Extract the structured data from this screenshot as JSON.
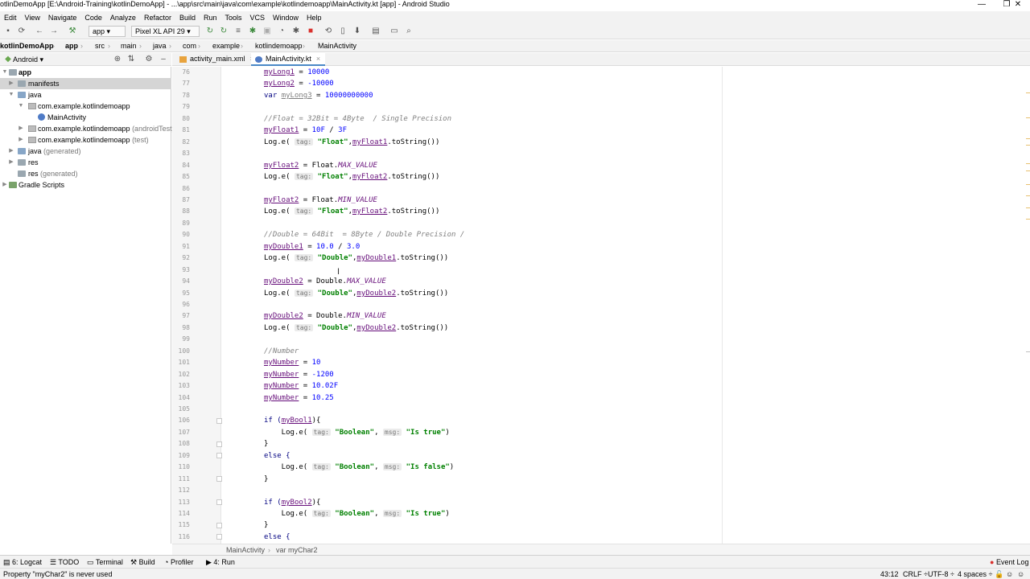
{
  "window": {
    "title": "otlinDemoApp [E:\\Android-Training\\kotlinDemoApp] - ...\\app\\src\\main\\java\\com\\example\\kotlindemoapp\\MainActivity.kt [app] - Android Studio",
    "minimize": "—",
    "restore": "❐",
    "close": "✕"
  },
  "menu": [
    "Edit",
    "View",
    "Navigate",
    "Code",
    "Analyze",
    "Refactor",
    "Build",
    "Run",
    "Tools",
    "VCS",
    "Window",
    "Help"
  ],
  "toolbar": {
    "module": "app ▾",
    "device": "Pixel XL API 29 ▾"
  },
  "nav": [
    "kotlinDemoApp",
    "app",
    "src",
    "main",
    "java",
    "com",
    "example",
    "kotlindemoapp",
    "MainActivity"
  ],
  "project": {
    "view": "Android ▾",
    "tree": [
      {
        "label": "app",
        "suffix": ""
      },
      {
        "label": "manifests",
        "suffix": ""
      },
      {
        "label": "java",
        "suffix": ""
      },
      {
        "label": "com.example.kotlindemoapp",
        "suffix": ""
      },
      {
        "label": "MainActivity",
        "suffix": ""
      },
      {
        "label": "com.example.kotlindemoapp",
        "suffix": " (androidTest)"
      },
      {
        "label": "com.example.kotlindemoapp",
        "suffix": " (test)"
      },
      {
        "label": "java",
        "suffix": " (generated)"
      },
      {
        "label": "res",
        "suffix": ""
      },
      {
        "label": "res",
        "suffix": " (generated)"
      },
      {
        "label": "Gradle Scripts",
        "suffix": ""
      }
    ]
  },
  "tabs": [
    {
      "label": "activity_main.xml",
      "close": "×"
    },
    {
      "label": "MainActivity.kt",
      "close": "×"
    }
  ],
  "code": {
    "line_numbers": [
      "76",
      "77",
      "78",
      "79",
      "80",
      "81",
      "82",
      "83",
      "84",
      "85",
      "86",
      "87",
      "88",
      "89",
      "90",
      "91",
      "92",
      "93",
      "94",
      "95",
      "96",
      "97",
      "98",
      "99",
      "100",
      "101",
      "102",
      "103",
      "104",
      "105",
      "106",
      "107",
      "108",
      "109",
      "110",
      "111",
      "112",
      "113",
      "114",
      "115",
      "116"
    ],
    "l76": {
      "var": "myLong1",
      "rest": " = ",
      "num": "10000"
    },
    "l77": {
      "var": "myLong2",
      "rest": " = ",
      "num": "-10000"
    },
    "l78": {
      "kw": "var ",
      "var": "myLong3",
      "rest": " = ",
      "num": "10000000000"
    },
    "l80": "//Float = 32Bit = 4Byte  / Single Precision",
    "l81": {
      "var": "myFloat1",
      "rest": " = ",
      "num1": "10F",
      "op": " / ",
      "num2": "3F"
    },
    "l82": {
      "pre": "Log.e( ",
      "hint": "tag:",
      "str": "\"Float\"",
      "comma": ",",
      "var": "myFloat1",
      "post": ".toString())"
    },
    "l84": {
      "var": "myFloat2",
      "rest": " = Float.",
      "const": "MAX_VALUE"
    },
    "l85": {
      "pre": "Log.e( ",
      "hint": "tag:",
      "str": "\"Float\"",
      "comma": ",",
      "var": "myFloat2",
      "post": ".toString())"
    },
    "l87": {
      "var": "myFloat2",
      "rest": " = Float.",
      "const": "MIN_VALUE"
    },
    "l88": {
      "pre": "Log.e( ",
      "hint": "tag:",
      "str": "\"Float\"",
      "comma": ",",
      "var": "myFloat2",
      "post": ".toString())"
    },
    "l90": "//Double = 64Bit  = 8Byte / Double Precision /",
    "l91": {
      "var": "myDouble1",
      "rest": " = ",
      "num1": "10.0",
      "op": " / ",
      "num2": "3.0"
    },
    "l92": {
      "pre": "Log.e( ",
      "hint": "tag:",
      "str": "\"Double\"",
      "comma": ",",
      "var": "myDouble1",
      "post": ".toString())"
    },
    "l94": {
      "var": "myDouble2",
      "rest": " = Double.",
      "const": "MAX_VALUE"
    },
    "l95": {
      "pre": "Log.e( ",
      "hint": "tag:",
      "str": "\"Double\"",
      "comma": ",",
      "var": "myDouble2",
      "post": ".toString())"
    },
    "l97": {
      "var": "myDouble2",
      "rest": " = Double.",
      "const": "MIN_VALUE"
    },
    "l98": {
      "pre": "Log.e( ",
      "hint": "tag:",
      "str": "\"Double\"",
      "comma": ",",
      "var": "myDouble2",
      "post": ".toString())"
    },
    "l100": "//Number",
    "l101": {
      "var": "myNumber",
      "rest": " = ",
      "num": "10"
    },
    "l102": {
      "var": "myNumber",
      "rest": " = ",
      "num": "-1200"
    },
    "l103": {
      "var": "myNumber",
      "rest": " = ",
      "num": "10.02F"
    },
    "l104": {
      "var": "myNumber",
      "rest": " = ",
      "num": "10.25"
    },
    "l106": {
      "pre": "if (",
      "var": "myBool1",
      "post": "){"
    },
    "l107": {
      "pre": "    Log.e( ",
      "hint1": "tag:",
      "str1": "\"Boolean\"",
      "comma": ", ",
      "hint2": "msg:",
      "str2": "\"Is true\"",
      "post": ")"
    },
    "l108": "}",
    "l109": "else {",
    "l110": {
      "pre": "    Log.e( ",
      "hint1": "tag:",
      "str1": "\"Boolean\"",
      "comma": ", ",
      "hint2": "msg:",
      "str2": "\"Is false\"",
      "post": ")"
    },
    "l111": "}",
    "l113": {
      "pre": "if (",
      "var": "myBool2",
      "post": "){"
    },
    "l114": {
      "pre": "    Log.e( ",
      "hint1": "tag:",
      "str1": "\"Boolean\"",
      "comma": ", ",
      "hint2": "msg:",
      "str2": "\"Is true\"",
      "post": ")"
    },
    "l115": "}",
    "l116": "else {"
  },
  "editor_breadcrumb": [
    "MainActivity",
    "var myChar2"
  ],
  "bottom_tools": {
    "logcat": "6: Logcat",
    "todo": "TODO",
    "terminal": "Terminal",
    "build": "Build",
    "profiler": "Profiler",
    "run": "4: Run",
    "event_log": "Event Log"
  },
  "status": {
    "message": "Property \"myChar2\" is never used",
    "position": "43:12",
    "line_sep": "CRLF ÷",
    "encoding": "UTF-8 ÷",
    "indent": "4 spaces ÷"
  },
  "colors": {
    "variable": "#660e7a",
    "number": "#0000ff",
    "string": "#008000",
    "comment": "#808080",
    "accent": "#4a88c7"
  }
}
